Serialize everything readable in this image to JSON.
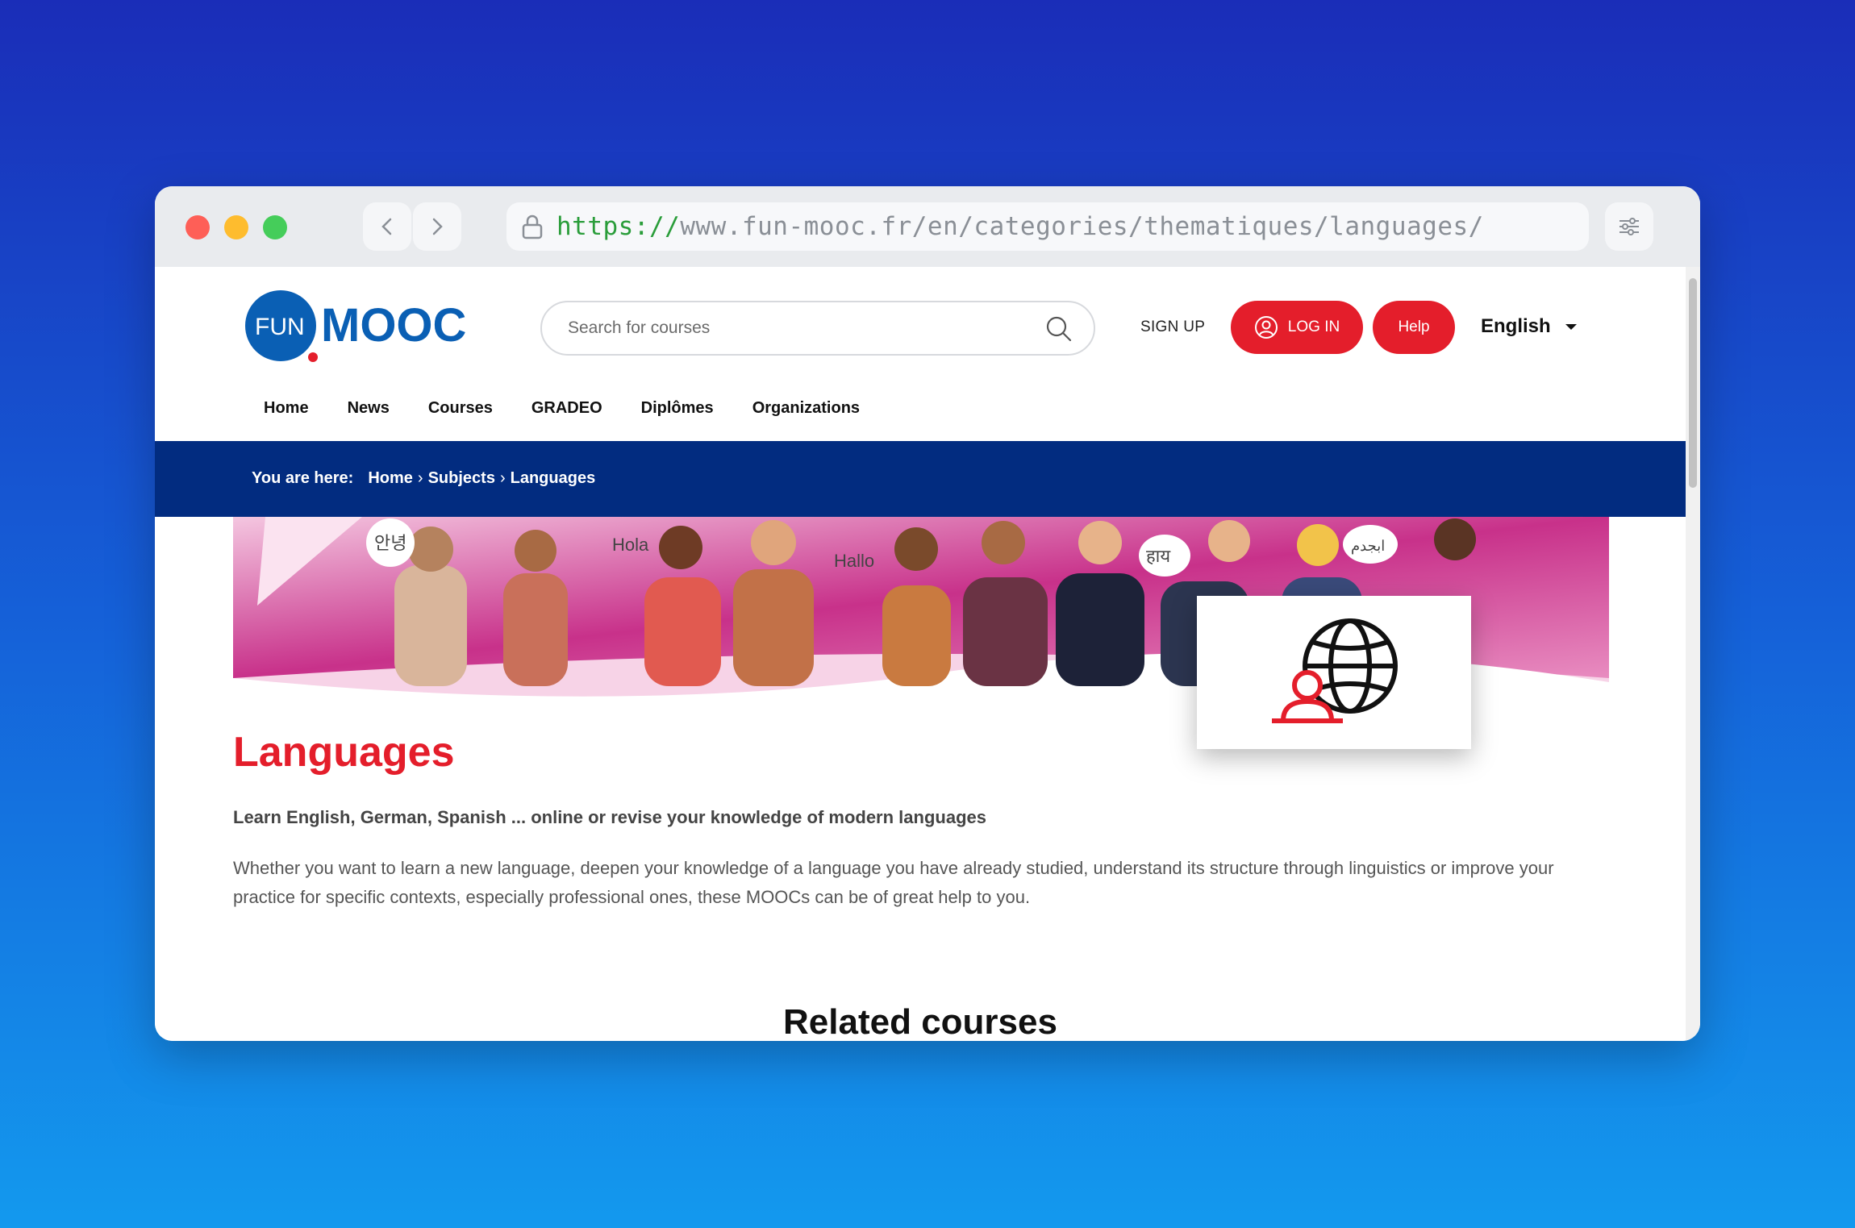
{
  "browser": {
    "url_scheme": "https://",
    "url_rest": "www.fun-mooc.fr/en/categories/thematiques/languages/"
  },
  "header": {
    "logo_fun": "FUN",
    "logo_mooc": "MOOC",
    "search_placeholder": "Search for courses",
    "signup": "SIGN UP",
    "login": "LOG IN",
    "help": "Help",
    "language": "English"
  },
  "nav": [
    "Home",
    "News",
    "Courses",
    "GRADEO",
    "Diplômes",
    "Organizations"
  ],
  "breadcrumb": {
    "label": "You are here:",
    "items": [
      "Home",
      "Subjects",
      "Languages"
    ]
  },
  "banner": {
    "greetings": [
      "안녕",
      "Hola",
      "Hallo",
      "हाय",
      "ابجدم"
    ]
  },
  "content": {
    "title": "Languages",
    "lead": "Learn English, German, Spanish ... online or revise your knowledge of modern languages",
    "body": "Whether you want to learn a new language, deepen your knowledge of a language you have already studied, understand its structure through linguistics or improve your practice for specific contexts, especially professional ones, these MOOCs can be of great help to you.",
    "related_heading": "Related courses"
  },
  "colors": {
    "brand_red": "#e41e2b",
    "brand_blue": "#0a5fb4",
    "nav_bar": "#022c80"
  }
}
